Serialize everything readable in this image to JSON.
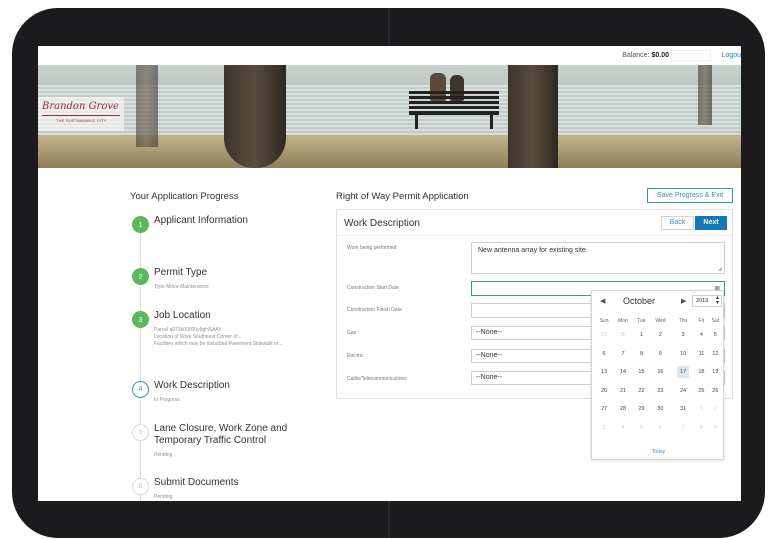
{
  "header": {
    "balance_label": "Balance:",
    "balance_value": "$0.00",
    "logout_label": "Logou"
  },
  "logo": {
    "title": "Brandon Grove",
    "tagline": "THE SUSTAINABLE CITY"
  },
  "progress": {
    "title": "Your Application Progress",
    "steps": [
      {
        "number": "1",
        "title": "Applicant Information",
        "sub": "",
        "state": "done"
      },
      {
        "number": "2",
        "title": "Permit Type",
        "sub": "Type  Minor Maintenance",
        "state": "done"
      },
      {
        "number": "3",
        "title": "Job Location",
        "sub": "Parcel  a073k00000y9gHSAAY\nLocation of Work  Southeast Corner of...\nFacilities which may be disturbed  Pavement,Sidewalk or...",
        "state": "done"
      },
      {
        "number": "4",
        "title": "Work Description",
        "sub": "In Progress",
        "state": "current"
      },
      {
        "number": "5",
        "title": "Lane Closure, Work Zone and Temporary Traffic Control",
        "sub": "Pending",
        "state": "pending"
      },
      {
        "number": "6",
        "title": "Submit Documents",
        "sub": "Pending",
        "state": "pending"
      }
    ]
  },
  "form": {
    "title": "Right of Way Permit Application",
    "save_label": "Save Progress & Exit",
    "card_title": "Work Description",
    "back_label": "Back",
    "next_label": "Next",
    "fields": {
      "work_label": "Work being performed",
      "work_value": "New antenna array for existing site",
      "start_label": "Construction Start Date",
      "start_value": "",
      "finish_label": "Construction Finish Date",
      "finish_value": "",
      "gas_label": "Gas",
      "gas_value": "--None--",
      "electric_label": "Electric",
      "electric_value": "--None--",
      "cable_label": "Cable/Telecommunications",
      "cable_value": "--None--"
    }
  },
  "datepicker": {
    "month": "October",
    "year": "2019",
    "today_label": "Today",
    "weekdays": [
      "Sun",
      "Mon",
      "Tue",
      "Wed",
      "Thu",
      "Fri",
      "Sat"
    ],
    "weeks": [
      [
        "29",
        "30",
        "1",
        "2",
        "3",
        "4",
        "5"
      ],
      [
        "6",
        "7",
        "8",
        "9",
        "10",
        "11",
        "12"
      ],
      [
        "13",
        "14",
        "15",
        "16",
        "17",
        "18",
        "19"
      ],
      [
        "20",
        "21",
        "22",
        "23",
        "24",
        "25",
        "26"
      ],
      [
        "27",
        "28",
        "29",
        "30",
        "31",
        "1",
        "2"
      ],
      [
        "3",
        "4",
        "5",
        "6",
        "7",
        "8",
        "9"
      ]
    ],
    "today": "17"
  }
}
